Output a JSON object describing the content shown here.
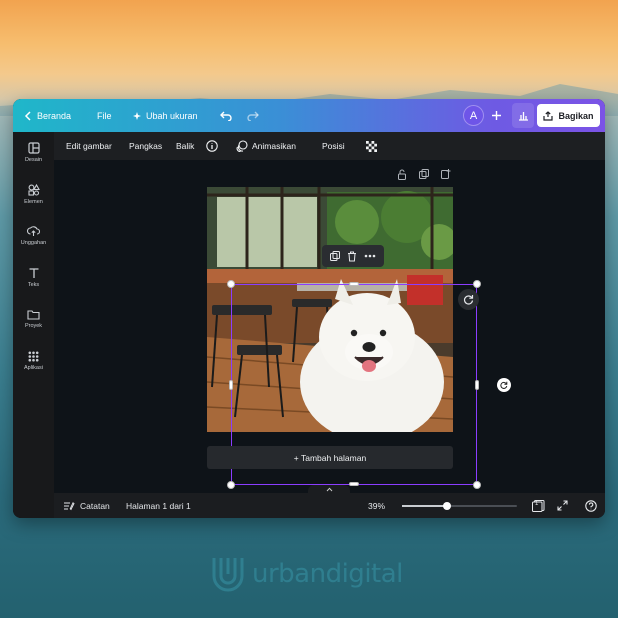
{
  "topbar": {
    "home_label": "Beranda",
    "file_label": "File",
    "resize_label": "Ubah ukuran",
    "avatar_initial": "A",
    "share_label": "Bagikan"
  },
  "sidebar": {
    "items": [
      {
        "label": "Desain",
        "icon": "layout-icon"
      },
      {
        "label": "Elemen",
        "icon": "shapes-icon"
      },
      {
        "label": "Unggahan",
        "icon": "cloud-upload-icon"
      },
      {
        "label": "Teks",
        "icon": "text-icon"
      },
      {
        "label": "Proyek",
        "icon": "folder-icon"
      },
      {
        "label": "Aplikasi",
        "icon": "apps-grid-icon"
      }
    ]
  },
  "toolbar": {
    "edit_image": "Edit gambar",
    "crop": "Pangkas",
    "flip": "Balik",
    "animate": "Animasikan",
    "position": "Posisi"
  },
  "canvas": {
    "add_page": "+ Tambah halaman"
  },
  "bottombar": {
    "notes": "Catatan",
    "page_indicator": "Halaman 1 dari 1",
    "zoom": "39%",
    "zoom_fraction": 0.39,
    "page_count": "1"
  },
  "watermark": {
    "text": "urbandigital"
  },
  "colors": {
    "selection": "#8b3dff",
    "accent_purple": "#7b53e6",
    "accent_teal": "#1fb7c9"
  }
}
